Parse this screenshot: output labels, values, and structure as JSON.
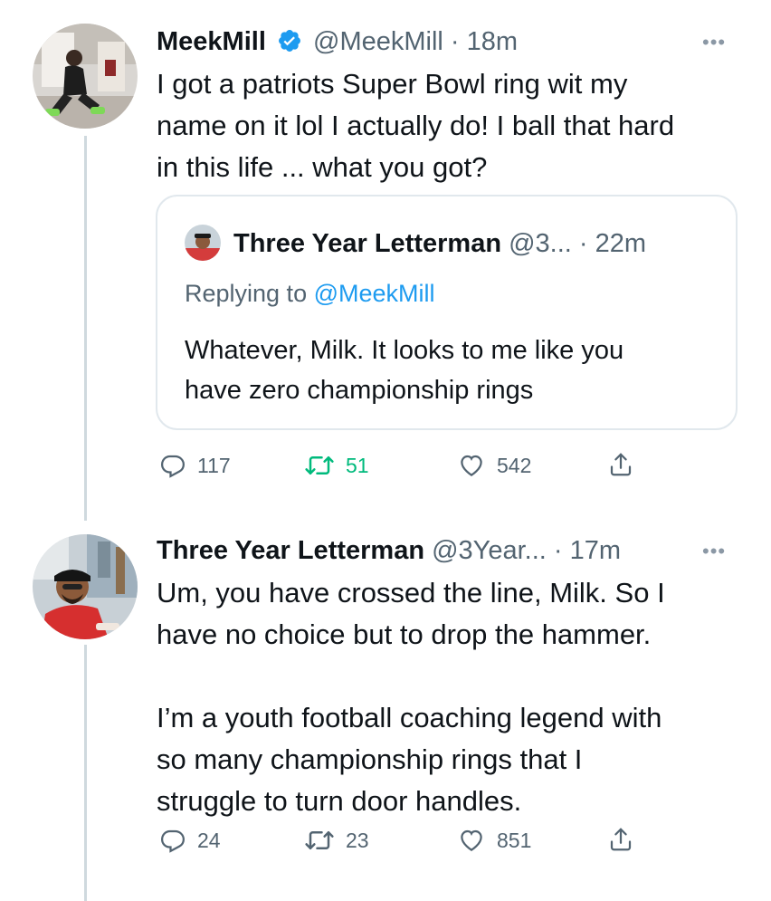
{
  "tweet1": {
    "name": "MeekMill",
    "verified": true,
    "handle": "@MeekMill",
    "dot": "·",
    "time": "18m",
    "more": "•••",
    "lines": [
      "I got a patriots Super Bowl ring wit my",
      "name on it lol I actually do! I ball that hard",
      "in this life ... what you got?"
    ],
    "quote": {
      "name": "Three Year Letterman",
      "handle": "@3...",
      "dot": "·",
      "time": "22m",
      "replying_prefix": "Replying to ",
      "replying_handle": "@MeekMill",
      "lines": [
        "Whatever, Milk. It looks to me like you",
        "have zero championship rings"
      ]
    },
    "actions": {
      "replies": "117",
      "retweets": "51",
      "likes": "542"
    }
  },
  "tweet2": {
    "name": "Three Year Letterman",
    "handle": "@3Year...",
    "dot": "·",
    "time": "17m",
    "more": "•••",
    "lines": [
      "Um, you have crossed the line, Milk. So I",
      "have no choice but to drop the hammer.",
      "",
      "I’m a youth football coaching legend with",
      "so many championship rings that I",
      "struggle to turn door handles."
    ],
    "actions": {
      "replies": "24",
      "retweets": "23",
      "likes": "851"
    }
  },
  "colors": {
    "verified": "#1d9bf0",
    "retweet_active": "#00ba7c",
    "secondary_text": "#536471",
    "thread_line": "#cfd9de"
  },
  "icons": [
    "verified-badge-icon",
    "reply-icon",
    "retweet-icon",
    "like-icon",
    "share-icon",
    "more-icon"
  ]
}
